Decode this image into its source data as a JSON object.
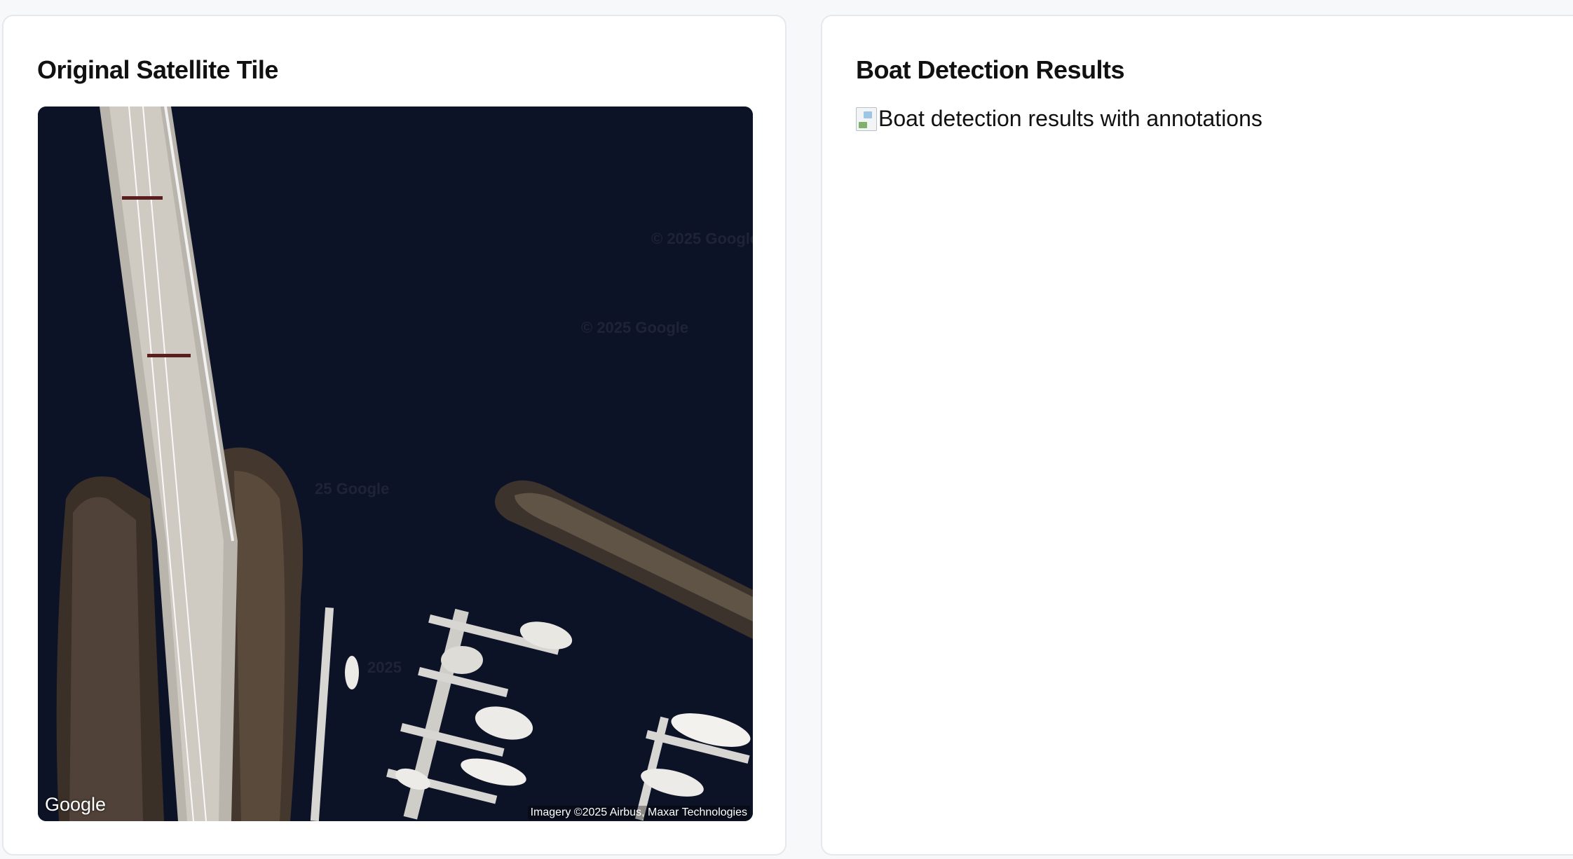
{
  "left_panel": {
    "title": "Original Satellite Tile",
    "map_logo": "Google",
    "attribution": "Imagery ©2025 Airbus, Maxar Technologies",
    "watermarks": [
      "© 2025 Google",
      "© 2025 Google",
      "25 Google",
      "2025"
    ]
  },
  "right_panel": {
    "title": "Boat Detection Results",
    "image_alt": "Boat detection results with annotations"
  }
}
